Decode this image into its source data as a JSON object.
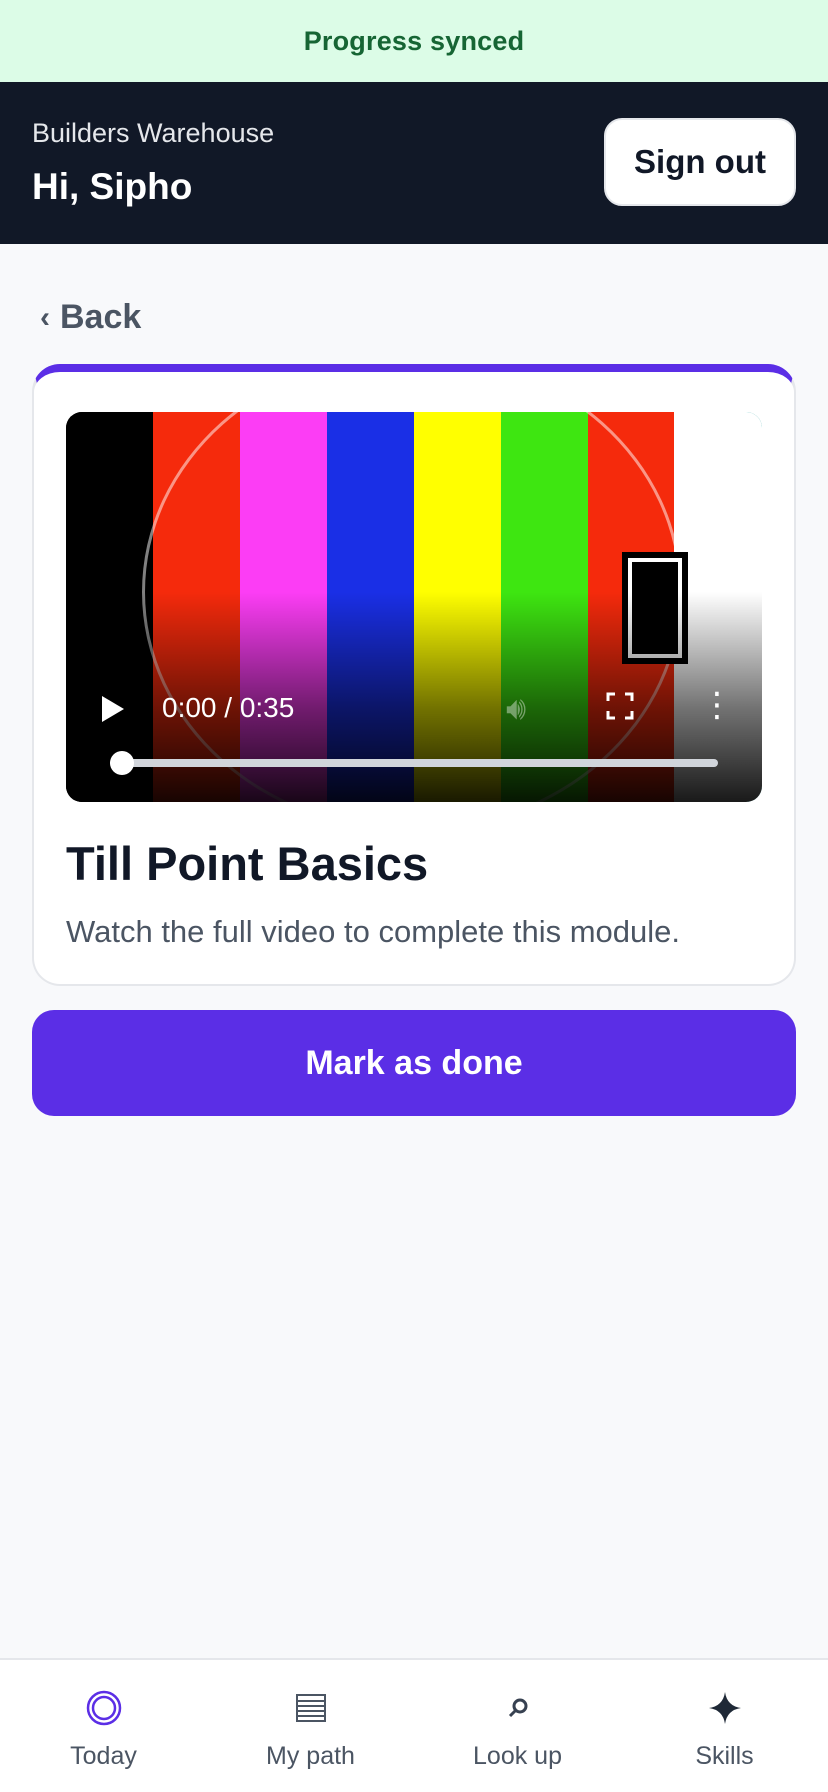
{
  "banner": {
    "text": "Progress synced"
  },
  "header": {
    "org": "Builders Warehouse",
    "greeting": "Hi, Sipho",
    "signout_label": "Sign out"
  },
  "back": {
    "label": "Back"
  },
  "video": {
    "time": "0:00 / 0:35",
    "progress": 0,
    "bar_colors": [
      "#000000",
      "#f52a0c",
      "#fc3df5",
      "#1a2fe6",
      "#ffff00",
      "#3ee611",
      "#f52a0c",
      "#52f8f8"
    ]
  },
  "module": {
    "title": "Till Point Basics",
    "description": "Watch the full video to complete this module."
  },
  "actions": {
    "done_label": "Mark as done"
  },
  "tabs": [
    {
      "label": "Today",
      "icon": "target-icon",
      "active": true
    },
    {
      "label": "My path",
      "icon": "list-icon",
      "active": false
    },
    {
      "label": "Look up",
      "icon": "search-icon",
      "active": false
    },
    {
      "label": "Skills",
      "icon": "sparkle-icon",
      "active": false
    }
  ],
  "colors": {
    "accent": "#5b2ee6",
    "header_bg": "#111827",
    "banner_bg": "#dcfce7",
    "banner_text": "#166534"
  }
}
